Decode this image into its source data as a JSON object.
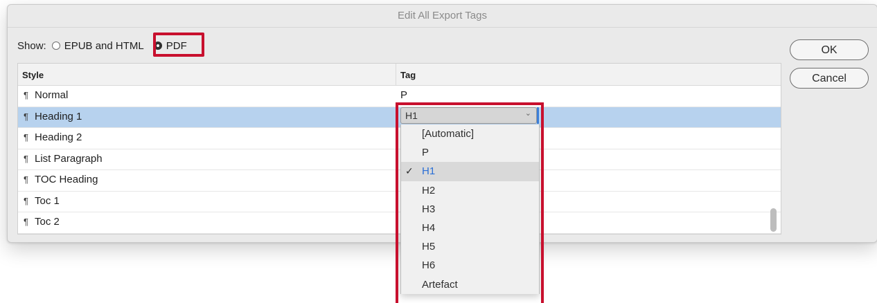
{
  "window": {
    "title": "Edit All Export Tags"
  },
  "show": {
    "label": "Show:",
    "options": [
      {
        "label": "EPUB and HTML",
        "checked": false
      },
      {
        "label": "PDF",
        "checked": true
      }
    ]
  },
  "table": {
    "headers": {
      "style": "Style",
      "tag": "Tag"
    },
    "pilcrow": "¶",
    "rows": [
      {
        "style": "Normal",
        "tag": "P"
      },
      {
        "style": "Heading 1",
        "tag": "H1"
      },
      {
        "style": "Heading 2",
        "tag": ""
      },
      {
        "style": "List Paragraph",
        "tag": ""
      },
      {
        "style": "TOC Heading",
        "tag": ""
      },
      {
        "style": "Toc 1",
        "tag": ""
      },
      {
        "style": "Toc 2",
        "tag": ""
      }
    ]
  },
  "buttons": {
    "ok": "OK",
    "cancel": "Cancel"
  },
  "tag_select": {
    "value": "H1",
    "chevron": "⌄",
    "options": [
      "[Automatic]",
      "P",
      "H1",
      "H2",
      "H3",
      "H4",
      "H5",
      "H6",
      "Artefact"
    ],
    "check": "✓"
  },
  "colors": {
    "highlight": "#c8102e",
    "selection": "#b7d2ee",
    "accent": "#2a6fd6"
  }
}
